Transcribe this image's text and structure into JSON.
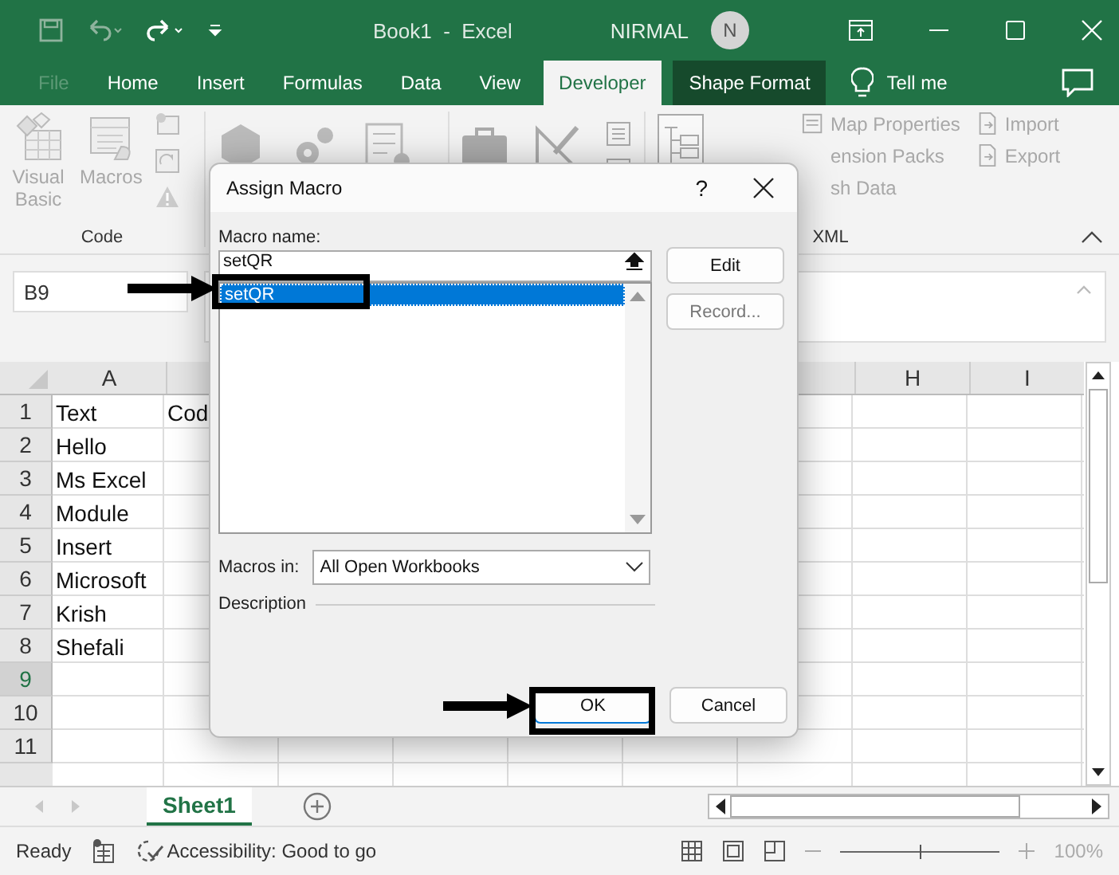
{
  "title_bar": {
    "title": "Book1  -  Excel",
    "user": "NIRMAL",
    "avatar": "N"
  },
  "ribbon_tabs": [
    {
      "label": "File",
      "selected": false,
      "disabled": true
    },
    {
      "label": "Home",
      "selected": false,
      "disabled": false
    },
    {
      "label": "Insert",
      "selected": false,
      "disabled": false
    },
    {
      "label": "Formulas",
      "selected": false,
      "disabled": false
    },
    {
      "label": "Data",
      "selected": false,
      "disabled": false
    },
    {
      "label": "View",
      "selected": false,
      "disabled": false
    },
    {
      "label": "Developer",
      "selected": true,
      "disabled": false
    },
    {
      "label": "Shape Format",
      "selected": false,
      "disabled": false,
      "contextual": true
    }
  ],
  "tell_me": "Tell me",
  "code_group": {
    "label": "Code",
    "commands": [
      "Visual Basic",
      "Macros"
    ]
  },
  "xml_group": {
    "label": "XML",
    "commands": [
      "Map Properties",
      "ension Packs",
      "sh Data"
    ],
    "side_commands": [
      "Import",
      "Export"
    ]
  },
  "name_box": "B9",
  "sheet": {
    "columns": [
      {
        "label": "A"
      },
      {},
      {},
      {},
      {},
      {},
      {},
      {
        "label": "H"
      },
      {
        "label": "I"
      }
    ],
    "rows": [
      {
        "number": "1",
        "selected": false,
        "cells": [
          "Text",
          "Cod"
        ]
      },
      {
        "number": "2",
        "selected": false,
        "cells": [
          "Hello"
        ]
      },
      {
        "number": "3",
        "selected": false,
        "cells": [
          "Ms Excel"
        ]
      },
      {
        "number": "4",
        "selected": false,
        "cells": [
          "Module"
        ]
      },
      {
        "number": "5",
        "selected": false,
        "cells": [
          "Insert"
        ]
      },
      {
        "number": "6",
        "selected": false,
        "cells": [
          "Microsoft"
        ]
      },
      {
        "number": "7",
        "selected": false,
        "cells": [
          "Krish"
        ]
      },
      {
        "number": "8",
        "selected": false,
        "cells": [
          "Shefali"
        ]
      },
      {
        "number": "9",
        "selected": true,
        "cells": []
      },
      {
        "number": "10",
        "selected": false,
        "cells": []
      },
      {
        "number": "11",
        "selected": false,
        "cells": []
      }
    ]
  },
  "sheet_tabs": [
    {
      "label": "Sheet1",
      "selected": true
    }
  ],
  "dialog": {
    "title": "Assign Macro",
    "help": "?",
    "macro_name_label": "Macro name:",
    "macro_name": "setQR",
    "macros": [
      {
        "name": "setQR",
        "selected": true
      }
    ],
    "side_buttons": [
      {
        "label": "Edit",
        "disabled": false
      },
      {
        "label": "Record...",
        "disabled": true
      }
    ],
    "macros_in_label": "Macros in:",
    "macros_in": "All Open Workbooks",
    "description_label": "Description",
    "footer_buttons": [
      {
        "label": "OK",
        "default": true
      },
      {
        "label": "Cancel",
        "default": false
      }
    ]
  },
  "status_bar": {
    "ready": "Ready",
    "accessibility": "Accessibility: Good to go",
    "zoom": {
      "level": 0.5,
      "reading": "100%"
    }
  }
}
